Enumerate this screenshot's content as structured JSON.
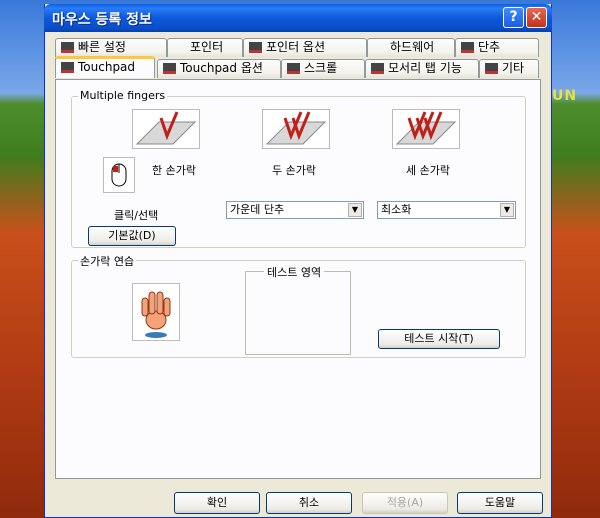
{
  "window": {
    "title": "마우스 등록 정보"
  },
  "desktop": {
    "text": "UN"
  },
  "tabs_row1": [
    {
      "label": "빠른 설정"
    },
    {
      "label": "포인터"
    },
    {
      "label": "포인터 옵션"
    },
    {
      "label": "하드웨어"
    },
    {
      "label": "단추"
    }
  ],
  "tabs_row2": [
    {
      "label": "Touchpad"
    },
    {
      "label": "Touchpad 옵션"
    },
    {
      "label": "스크롤"
    },
    {
      "label": "모서리 탭 기능"
    },
    {
      "label": "기타"
    }
  ],
  "multiple_fingers": {
    "title": "Multiple fingers",
    "one_finger": "한 손가락",
    "two_finger": "두 손가락",
    "three_finger": "세 손가락",
    "click_select": "클릭/선택",
    "two_finger_select": "가운데 단추",
    "three_finger_select": "최소화",
    "default_button": "기본값(D)"
  },
  "practice": {
    "title": "손가락 연습",
    "test_area": "테스트 영역",
    "start_button": "테스트 시작(T)"
  },
  "footer": {
    "ok": "확인",
    "cancel": "취소",
    "apply": "적용(A)",
    "help": "도움말"
  }
}
